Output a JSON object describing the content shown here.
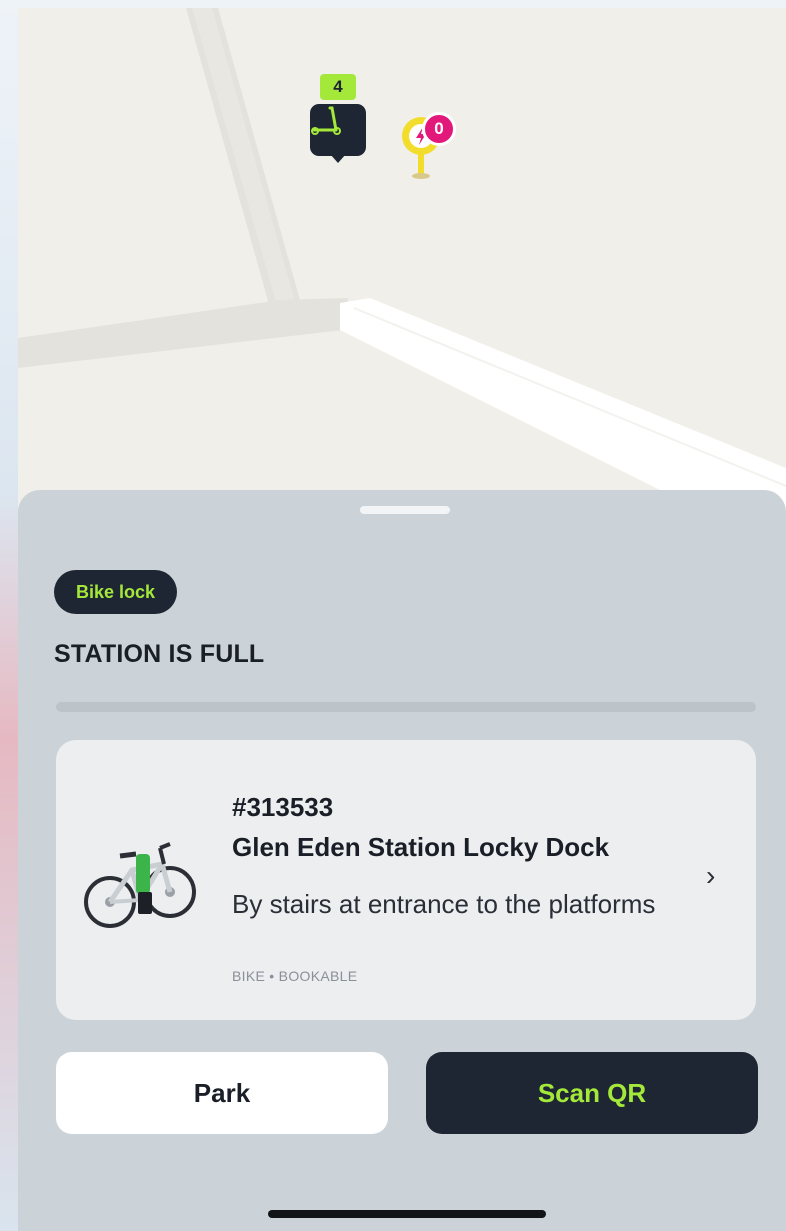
{
  "map": {
    "dock_pin": {
      "count": "4",
      "icon": "scooter-icon"
    },
    "charge_pin": {
      "count": "0",
      "icon": "lightning-icon"
    }
  },
  "sheet": {
    "tag_label": "Bike lock",
    "status": "STATION IS FULL",
    "station": {
      "id": "#313533",
      "name": "Glen Eden Station Locky Dock",
      "description": "By stairs at entrance to the platforms",
      "meta": "BIKE • BOOKABLE",
      "image": "bike-image",
      "chevron": "›"
    },
    "buttons": {
      "park": "Park",
      "scan": "Scan QR"
    }
  },
  "colors": {
    "accent": "#a4e83a",
    "dark": "#1f2633",
    "badge_pink": "#e2197b",
    "charge_yellow": "#f2dd2c"
  }
}
